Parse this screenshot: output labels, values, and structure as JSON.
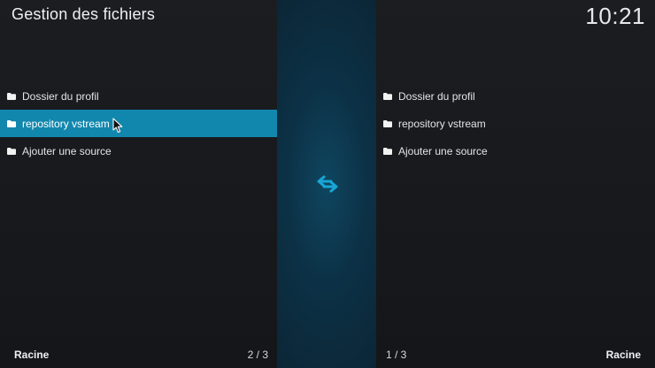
{
  "header": {
    "title": "Gestion des fichiers",
    "clock": "10:21"
  },
  "left_pane": {
    "items": [
      {
        "label": "Dossier du profil",
        "icon": "folder-icon"
      },
      {
        "label": "repository vstream",
        "icon": "folder-icon",
        "selected": true
      },
      {
        "label": "Ajouter une source",
        "icon": "folder-icon"
      }
    ],
    "footer_label": "Racine",
    "footer_count": "2 / 3"
  },
  "right_pane": {
    "items": [
      {
        "label": "Dossier du profil",
        "icon": "folder-icon"
      },
      {
        "label": "repository vstream",
        "icon": "folder-icon"
      },
      {
        "label": "Ajouter une source",
        "icon": "folder-icon"
      }
    ],
    "footer_label": "Racine",
    "footer_count": "1 / 3"
  },
  "center": {
    "icon": "swap-arrows-icon"
  },
  "colors": {
    "accent": "#1287ad",
    "swap_icon": "#19a6d6",
    "background": "#16181b"
  }
}
